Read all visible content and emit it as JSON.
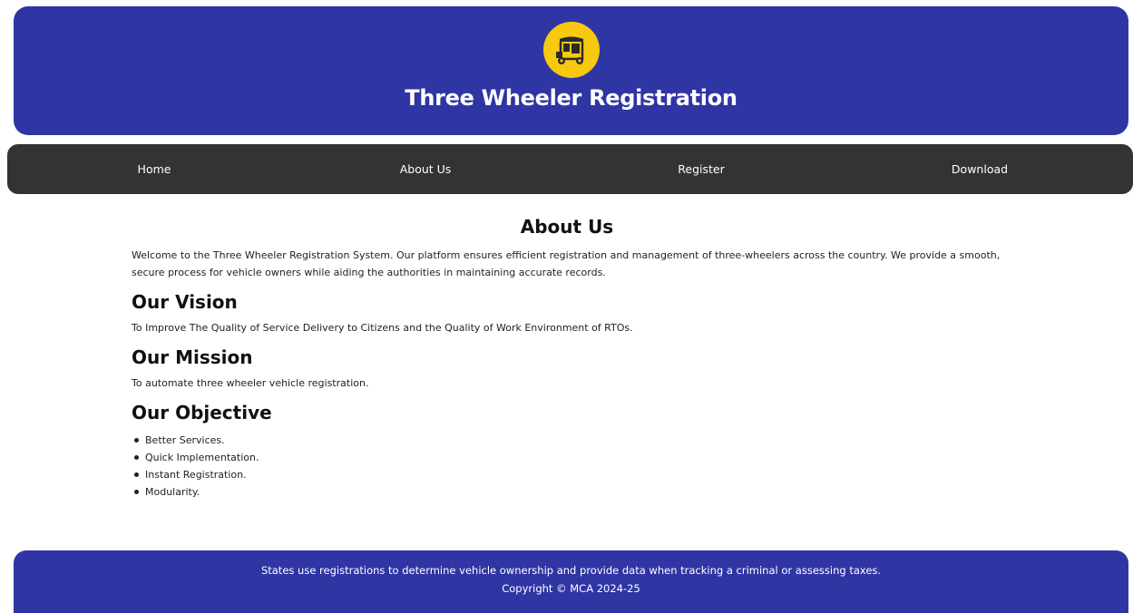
{
  "header": {
    "title": "Three Wheeler Registration",
    "logo_icon": "auto-rickshaw-icon",
    "logo_bg": "#f7c90f",
    "bg": "#3035a4"
  },
  "nav": {
    "items": [
      {
        "label": "Home"
      },
      {
        "label": "About Us"
      },
      {
        "label": "Register"
      },
      {
        "label": "Download"
      }
    ],
    "bg": "#333333"
  },
  "main": {
    "title": "About Us",
    "intro": "Welcome to the Three Wheeler Registration System. Our platform ensures efficient registration and management of three-wheelers across the country. We provide a smooth, secure process for vehicle owners while aiding the authorities in maintaining accurate records.",
    "vision": {
      "heading": "Our Vision",
      "text": "To Improve The Quality of Service Delivery to Citizens and the Quality of Work Environment of RTOs."
    },
    "mission": {
      "heading": "Our Mission",
      "text": "To automate three wheeler vehicle registration."
    },
    "objective": {
      "heading": "Our Objective",
      "items": [
        "Better Services.",
        "Quick Implementation.",
        "Instant Registration.",
        "Modularity."
      ]
    }
  },
  "footer": {
    "line1": "States use registrations to determine vehicle ownership and provide data when tracking a criminal or assessing taxes.",
    "copyright": "Copyright © MCA 2024-25"
  }
}
